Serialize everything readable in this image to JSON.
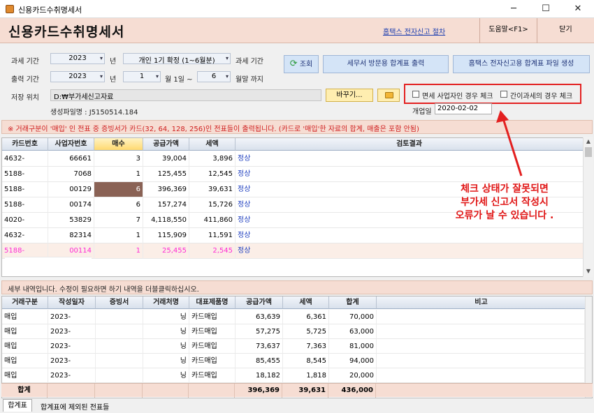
{
  "window": {
    "title": "신용카드수취명세서"
  },
  "header": {
    "title": "신용카드수취명세서",
    "hometax_link": "홈택스 전자신고 절차",
    "help_label": "도움말<F1>",
    "close_label": "닫기"
  },
  "form": {
    "tax_period_label": "과세 기간",
    "tax_year": "2023",
    "year_unit": "년",
    "tax_period_value": "개인 1기 확정 (1~6월분)",
    "tax_period_suffix": "과세 기간",
    "output_period_label": "출력 기간",
    "output_year": "2023",
    "month_from": "1",
    "month_from_suffix": "월 1일 ~",
    "month_to": "6",
    "month_to_suffix": "월말 까지",
    "query_label": "조회",
    "visit_print_label": "세무서 방문용 합계표 출력",
    "hometax_file_label": "홈택스 전자신고용 합계표 파일 생성",
    "save_location_label": "저장 위치",
    "save_path": "D:₩부가세신고자료",
    "generated_file_label": "생성파일명 : J5150514.184",
    "browse_label": "바꾸기...",
    "exempt_check_label": "면세 사업자인 경우 체크",
    "simplified_check_label": "간이과세의 경우 체크",
    "open_date_label": "개업일",
    "open_date": "2020-02-02"
  },
  "notice": "※ 거래구분이 '매입' 인 전표 중 증빙서가 카드(32, 64, 128, 256)인 전표들이 출력됩니다. (카드로 '매입'한 자료의 합계, 매출은 포함 안됨)",
  "summary_grid": {
    "columns": [
      "카드번호",
      "사업자번호",
      "매수",
      "공급가액",
      "세액",
      "검토결과"
    ],
    "rows": [
      {
        "card": "4632-",
        "biz": "66661",
        "count": "3",
        "supply": "39,004",
        "tax": "3,896",
        "result": "정상"
      },
      {
        "card": "5188-",
        "biz": "7068",
        "count": "1",
        "supply": "125,455",
        "tax": "12,545",
        "result": "정상"
      },
      {
        "card": "5188-",
        "biz": "00129",
        "count": "6",
        "supply": "396,369",
        "tax": "39,631",
        "result": "정상"
      },
      {
        "card": "5188-",
        "biz": "00174",
        "count": "6",
        "supply": "157,274",
        "tax": "15,726",
        "result": "정상"
      },
      {
        "card": "4020-",
        "biz": "53829",
        "count": "7",
        "supply": "4,118,550",
        "tax": "411,860",
        "result": "정상"
      },
      {
        "card": "4632-",
        "biz": "82314",
        "count": "1",
        "supply": "115,909",
        "tax": "11,591",
        "result": "정상"
      },
      {
        "card": "5188-",
        "biz": "00114",
        "count": "1",
        "supply": "25,455",
        "tax": "2,545",
        "result": "정상"
      }
    ]
  },
  "annotation": {
    "line1": "체크 상태가 잘못되면",
    "line2": "부가세 신고서 작성시",
    "line3": "오류가 날 수 있습니다 ."
  },
  "info_bar": "세부 내역입니다. 수정이 필요하면 하기 내역을 더블클릭하십시오.",
  "detail_grid": {
    "columns": [
      "거래구분",
      "작성일자",
      "증빙서",
      "거래처명",
      "대표제품명",
      "공급가액",
      "세액",
      "합계",
      "비고"
    ],
    "rows": [
      {
        "type": "매입",
        "date": "2023-",
        "proof": "",
        "vendor": "닝",
        "product": "카드매입",
        "supply": "63,639",
        "tax": "6,361",
        "total": "70,000",
        "note": ""
      },
      {
        "type": "매입",
        "date": "2023-",
        "proof": "",
        "vendor": "닝",
        "product": "카드매입",
        "supply": "57,275",
        "tax": "5,725",
        "total": "63,000",
        "note": ""
      },
      {
        "type": "매입",
        "date": "2023-",
        "proof": "",
        "vendor": "닝",
        "product": "카드매입",
        "supply": "73,637",
        "tax": "7,363",
        "total": "81,000",
        "note": ""
      },
      {
        "type": "매입",
        "date": "2023-",
        "proof": "",
        "vendor": "닝",
        "product": "카드매입",
        "supply": "85,455",
        "tax": "8,545",
        "total": "94,000",
        "note": ""
      },
      {
        "type": "매입",
        "date": "2023-",
        "proof": "",
        "vendor": "닝",
        "product": "카드매입",
        "supply": "18,182",
        "tax": "1,818",
        "total": "20,000",
        "note": ""
      }
    ],
    "total_label": "합계",
    "total_supply": "396,369",
    "total_tax": "39,631",
    "total_sum": "436,000"
  },
  "tabs": [
    "합계표",
    "합계표에 제외된 전표들"
  ],
  "colors": {
    "accent_red": "#e32020",
    "header_bg": "#f6ddd3",
    "link_blue": "#1b3db0",
    "pink_row": "#ff2ad4",
    "selected_cell": "#8a6255"
  }
}
